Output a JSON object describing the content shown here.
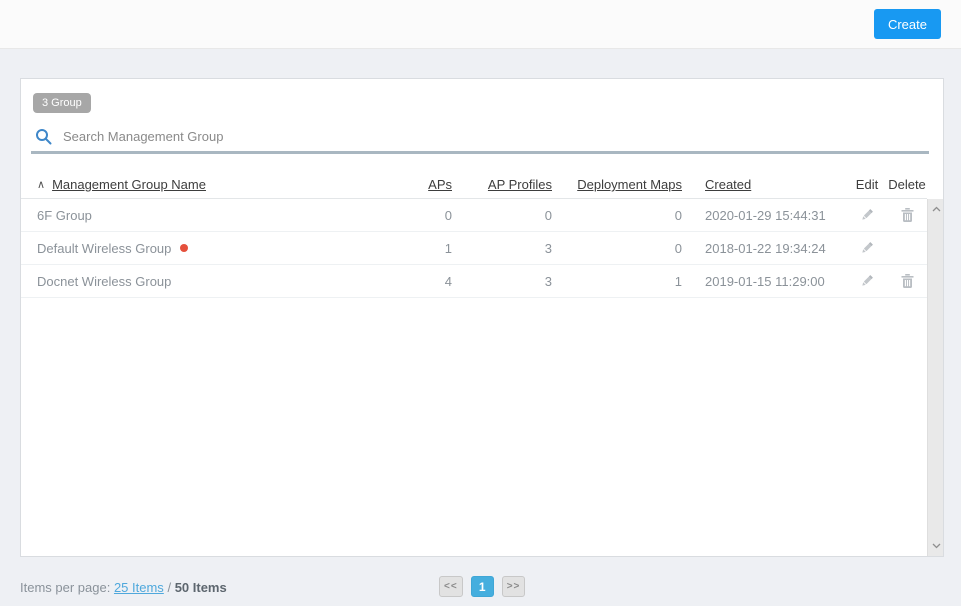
{
  "topbar": {
    "create_label": "Create"
  },
  "panel": {
    "badge": "3 Group",
    "search": {
      "placeholder": "Search Management Group"
    }
  },
  "table": {
    "sort_indicator": "∧",
    "columns": [
      {
        "label": "Management Group Name",
        "sortable": true
      },
      {
        "label": "APs",
        "sortable": true
      },
      {
        "label": "AP Profiles",
        "sortable": true
      },
      {
        "label": "Deployment Maps",
        "sortable": true
      },
      {
        "label": "Created",
        "sortable": true
      },
      {
        "label": "Edit",
        "sortable": false
      },
      {
        "label": "Delete",
        "sortable": false
      }
    ],
    "rows": [
      {
        "name": "6F Group",
        "aps": "0",
        "ap_profiles": "0",
        "deployment_maps": "0",
        "created": "2020-01-29 15:44:31",
        "has_status_dot": false,
        "has_edit": true,
        "has_delete": true
      },
      {
        "name": "Default Wireless Group",
        "aps": "1",
        "ap_profiles": "3",
        "deployment_maps": "0",
        "created": "2018-01-22 19:34:24",
        "has_status_dot": true,
        "has_edit": true,
        "has_delete": false
      },
      {
        "name": "Docnet Wireless Group",
        "aps": "4",
        "ap_profiles": "3",
        "deployment_maps": "1",
        "created": "2019-01-15 11:29:00",
        "has_status_dot": false,
        "has_edit": true,
        "has_delete": true
      }
    ]
  },
  "footer": {
    "items_per_page_label": "Items per page:",
    "page_size_link": "25 Items",
    "separator": "/",
    "total_label": "50 Items",
    "pagination": {
      "prev": "<<",
      "current": "1",
      "next": ">>"
    }
  },
  "icons": {
    "search-icon": "magnifier",
    "edit-icon": "pencil",
    "delete-icon": "trash-can",
    "sort-asc-icon": "chevron-up",
    "scroll-up-icon": "chevron-up",
    "scroll-down-icon": "chevron-down",
    "status-dot": "red-circle"
  },
  "colors": {
    "accent": "#1899f2",
    "active_page": "#45aede",
    "status_dot": "#e5503c",
    "badge_bg": "#a7a7a7",
    "search_underline": "#a9b7c1",
    "link": "#4fa8dc",
    "page_bg": "#eef0f4"
  }
}
